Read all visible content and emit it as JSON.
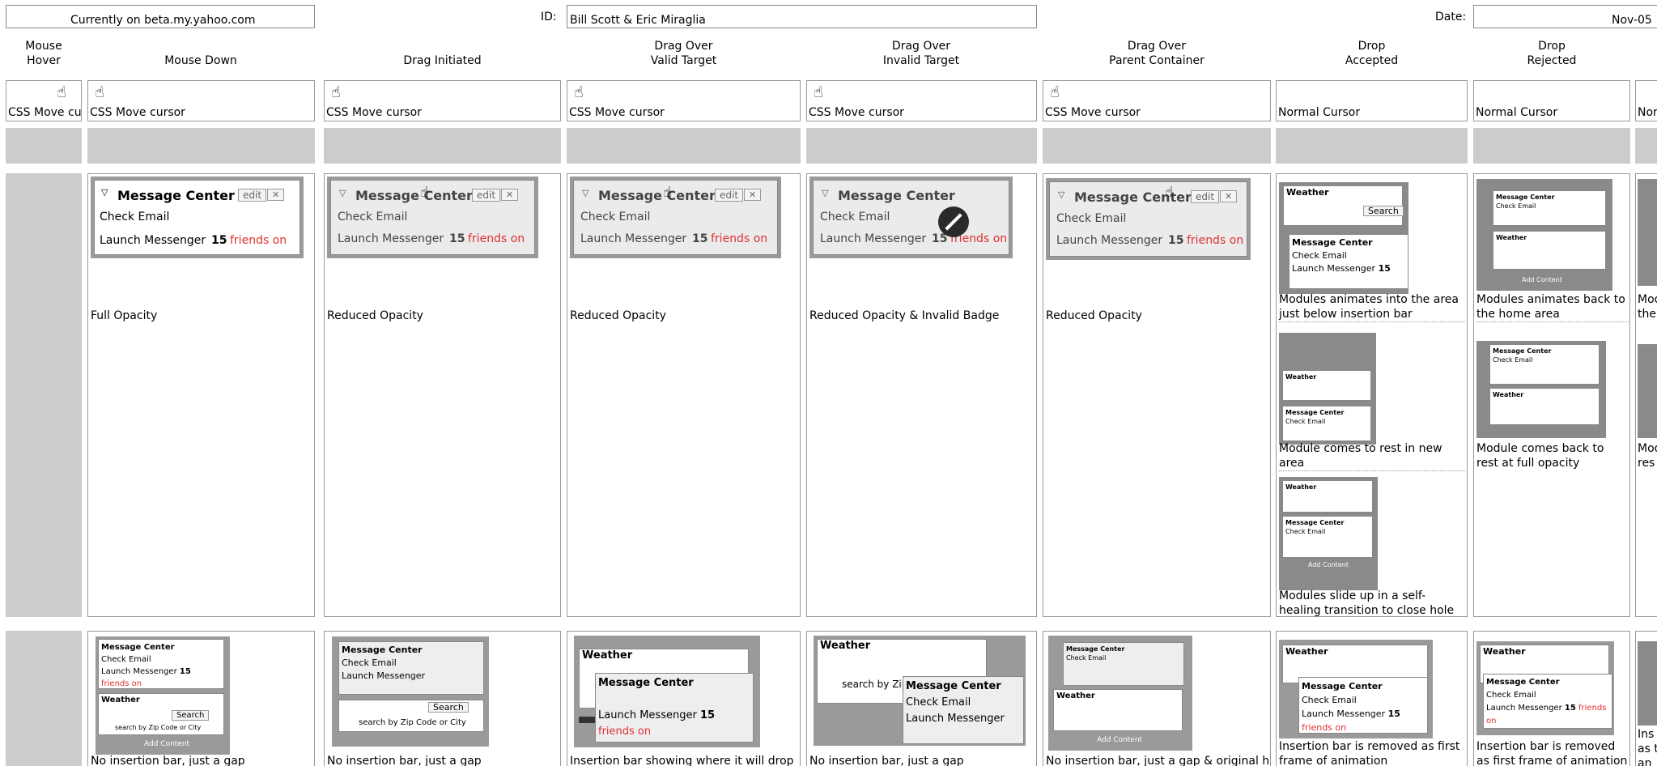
{
  "header": {
    "location": "Currently on beta.my.yahoo.com",
    "id_label": "ID:",
    "id_value": "Bill Scott & Eric Miraglia",
    "date_label": "Date:",
    "date_value": "Nov-05"
  },
  "columns": [
    {
      "title": "Mouse\nHover",
      "cursor": "CSS Move cursor"
    },
    {
      "title": "Mouse Down",
      "cursor": "CSS Move cursor"
    },
    {
      "title": "Drag Initiated",
      "cursor": "CSS Move cursor"
    },
    {
      "title": "Drag Over\nValid Target",
      "cursor": "CSS Move cursor"
    },
    {
      "title": "Drag Over\nInvalid Target",
      "cursor": "CSS Move cursor"
    },
    {
      "title": "Drag Over\nParent Container",
      "cursor": "CSS Move cursor"
    },
    {
      "title": "Drop\nAccepted",
      "cursor": "Normal Cursor"
    },
    {
      "title": "Drop\nRejected",
      "cursor": "Normal Cursor"
    },
    {
      "title": "",
      "cursor": "Nor"
    }
  ],
  "module": {
    "title": "Message Center",
    "edit": "edit",
    "close": "✕",
    "line1": "Check Email",
    "line2_prefix": "Launch Messenger",
    "line2_count": "15",
    "line2_suffix": "friends on",
    "weather_title": "Weather",
    "search_btn": "Search",
    "search_hint": "search by Zip Code or City",
    "add_content": "Add Content"
  },
  "row1_desc": [
    "Full Opacity",
    "Reduced Opacity",
    "Reduced Opacity",
    "Reduced Opacity & Invalid Badge",
    "Reduced Opacity"
  ],
  "drop_accepted_desc": [
    "Modules animates into the area just below insertion bar",
    "Module comes to rest in new area",
    "Modules slide up in a self-healing transition to close hole"
  ],
  "drop_rejected_desc": [
    "Modules animates back to the home area",
    "Module comes back to rest at full opacity"
  ],
  "partial_col_desc": [
    "Mod",
    "the",
    "Mod",
    "res"
  ],
  "row2_desc": [
    "No insertion bar, just a gap",
    "No insertion bar, just a gap",
    "Insertion bar showing where it will drop",
    "No insertion bar, just a gap",
    "No insertion bar, just a gap & original hole",
    "Insertion bar is removed as first frame of animation",
    "Insertion bar is removed as first frame of animation",
    "Ins as t an"
  ]
}
